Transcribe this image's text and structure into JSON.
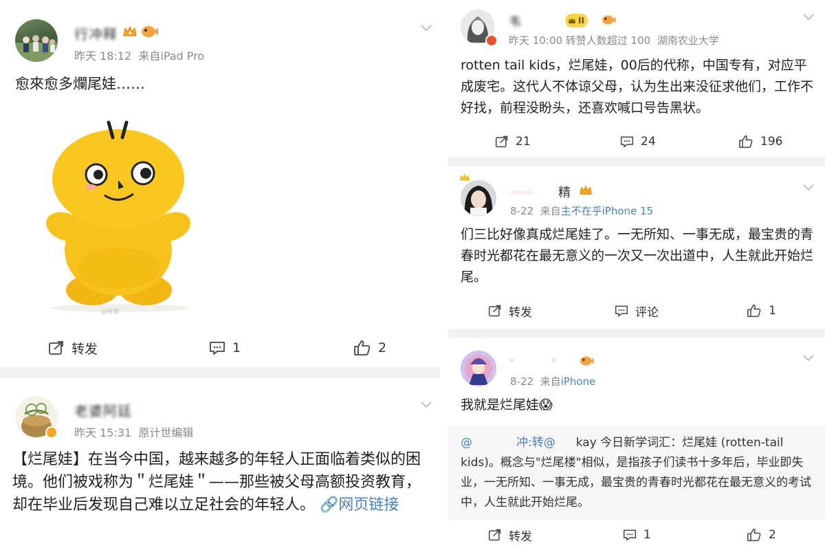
{
  "left": {
    "post1": {
      "username": "行冲释",
      "time": "昨天 18:12",
      "source": "来自iPad Pro",
      "text": "愈來愈多爛尾娃……",
      "image_watermark": "@微博",
      "repost_label": "转发",
      "comment_count": "1",
      "like_count": "2"
    },
    "post2": {
      "username": "老婆阿廷",
      "time": "昨天 15:31",
      "source": "原计世编辑",
      "text": "【烂尾娃】在当今中国，越来越多的年轻人正面临着类似的困境。他们被戏称为＂烂尾娃＂——那些被父母高额投资教育，却在毕业后发现自己难以立足社会的年轻人。",
      "link_label": "网页链接"
    }
  },
  "right": {
    "post1": {
      "username": "韦",
      "level_badge": "II",
      "time": "昨天 10:00",
      "meta_extra": "转赞人数超过 100",
      "school": "湖南农业大学",
      "text": "rotten tail kids，烂尾娃，00后的代称，中国专有，对应平成废宅。这代人不体谅父母，认为生出来没征求他们，工作不好找，前程没盼头，还喜欢喊口号告黑状。",
      "repost_count": "21",
      "comment_count": "24",
      "like_count": "196"
    },
    "post2": {
      "username": "精",
      "time": "8-22",
      "source_prefix": "来自",
      "source": "主不在乎iPhone 15",
      "text": "们三比好像真成烂尾娃了。一无所知、一事无成，最宝贵的青春时光都花在最无意义的一次又一次出道中，人生就此开始烂尾。",
      "repost_label": "转发",
      "comment_label": "评论",
      "like_count": "1"
    },
    "post3": {
      "time": "8-22",
      "source_prefix": "来自",
      "source": "iPhone",
      "text": "我就是烂尾娃😱",
      "repost_text_a": "@",
      "repost_text_b": "冲:转@",
      "repost_text_c": "kay 今日新学词汇：烂尾娃 (rotten-tail kids)。概念与\"烂尾楼\"相似，是指孩子们读书十多年后，毕业即失业，一无所知、一事无成，最宝贵的青春时光都花在最无意义的考试中，人生就此开始烂尾。",
      "repost_label": "转发",
      "comment_count": "1",
      "like_count": "2"
    }
  },
  "colors": {
    "link": "#4a7fc0",
    "meta": "#8a8a8a",
    "divider": "#f1f1f1",
    "plush": "#f7c21b",
    "orange": "#f07b2e"
  }
}
